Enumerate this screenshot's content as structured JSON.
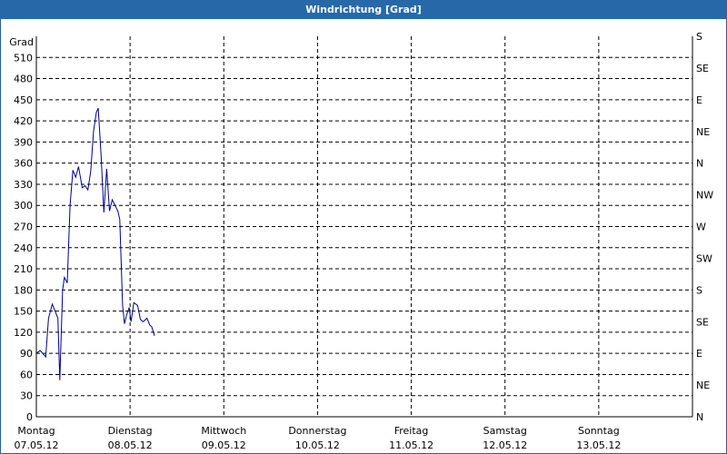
{
  "window": {
    "title": "Windrichtung [Grad]"
  },
  "chart_data": {
    "type": "line",
    "title": "Windrichtung [Grad]",
    "ylabel": "Grad",
    "ylim": [
      0,
      540
    ],
    "yticks": [
      0,
      30,
      60,
      90,
      120,
      150,
      180,
      210,
      240,
      270,
      300,
      330,
      360,
      390,
      420,
      450,
      480,
      510
    ],
    "right_ticks": [
      {
        "value": 0,
        "label": "N"
      },
      {
        "value": 30,
        "label": "NE"
      },
      {
        "value": 60,
        "label": "E"
      },
      {
        "value": 90,
        "label": "SE"
      },
      {
        "value": 120,
        "label": "S"
      },
      {
        "value": 150,
        "label": "SW"
      },
      {
        "value": 180,
        "label": "W"
      },
      {
        "value": 210,
        "label": "NW"
      },
      {
        "value": 240,
        "label": "N"
      },
      {
        "value": 270,
        "label": "NE"
      },
      {
        "value": 300,
        "label": "E"
      },
      {
        "value": 330,
        "label": "SE"
      },
      {
        "value": 360,
        "label": "S"
      }
    ],
    "xlim": [
      0,
      7
    ],
    "x_days": [
      {
        "day": "Montag",
        "date": "07.05.12"
      },
      {
        "day": "Dienstag",
        "date": "08.05.12"
      },
      {
        "day": "Mittwoch",
        "date": "09.05.12"
      },
      {
        "day": "Donnerstag",
        "date": "10.05.12"
      },
      {
        "day": "Freitag",
        "date": "11.05.12"
      },
      {
        "day": "Samstag",
        "date": "12.05.12"
      },
      {
        "day": "Sonntag",
        "date": "13.05.12"
      }
    ],
    "grid": true,
    "series": [
      {
        "color": "#00008b",
        "points": [
          [
            0.0,
            90
          ],
          [
            0.04,
            94
          ],
          [
            0.08,
            88
          ],
          [
            0.1,
            85
          ],
          [
            0.13,
            140
          ],
          [
            0.17,
            160
          ],
          [
            0.2,
            150
          ],
          [
            0.23,
            140
          ],
          [
            0.25,
            52
          ],
          [
            0.28,
            180
          ],
          [
            0.3,
            198
          ],
          [
            0.33,
            190
          ],
          [
            0.36,
            300
          ],
          [
            0.39,
            350
          ],
          [
            0.42,
            340
          ],
          [
            0.45,
            355
          ],
          [
            0.49,
            325
          ],
          [
            0.52,
            328
          ],
          [
            0.55,
            322
          ],
          [
            0.58,
            348
          ],
          [
            0.61,
            405
          ],
          [
            0.64,
            432
          ],
          [
            0.66,
            438
          ],
          [
            0.69,
            372
          ],
          [
            0.72,
            290
          ],
          [
            0.75,
            352
          ],
          [
            0.78,
            292
          ],
          [
            0.81,
            308
          ],
          [
            0.84,
            300
          ],
          [
            0.87,
            292
          ],
          [
            0.89,
            280
          ],
          [
            0.9,
            240
          ],
          [
            0.92,
            158
          ],
          [
            0.94,
            132
          ],
          [
            0.96,
            143
          ],
          [
            0.99,
            155
          ],
          [
            1.01,
            135
          ],
          [
            1.04,
            162
          ],
          [
            1.08,
            158
          ],
          [
            1.11,
            138
          ],
          [
            1.14,
            135
          ],
          [
            1.18,
            140
          ],
          [
            1.21,
            130
          ],
          [
            1.23,
            128
          ],
          [
            1.26,
            115
          ]
        ]
      }
    ]
  }
}
